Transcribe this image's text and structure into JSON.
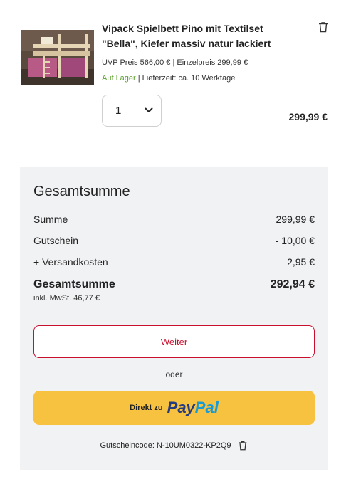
{
  "product": {
    "title": "Vipack Spielbett Pino mit Textilset \"Bella\", Kiefer massiv natur lackiert",
    "uvp_label": "UVP Preis",
    "uvp_value": "566,00 €",
    "unit_label": "| Einzelpreis",
    "unit_value": "299,99 €",
    "stock": "Auf Lager",
    "delivery_label": "| Lieferzeit:",
    "delivery_value": "ca. 10 Werktage",
    "quantity": "1",
    "total": "299,99 €",
    "remove_icon": "trash-icon"
  },
  "summary": {
    "heading": "Gesamtsumme",
    "rows": [
      {
        "label": "Summe",
        "value": "299,99 €"
      },
      {
        "label": "Gutschein",
        "value": "- 10,00 €"
      },
      {
        "label": "+ Versandkosten",
        "value": "2,95 €"
      }
    ],
    "total_label": "Gesamtsumme",
    "total_value": "292,94 €",
    "vat": "inkl. MwSt. 46,77 €"
  },
  "actions": {
    "continue_label": "Weiter",
    "or_label": "oder",
    "paypal_prefix": "Direkt zu",
    "paypal_word1": "Pay",
    "paypal_word2": "Pal"
  },
  "coupon": {
    "text": "Gutscheincode: N-10UM0322-KP2Q9",
    "remove_icon": "trash-icon"
  },
  "colors": {
    "accent_red": "#c8102e",
    "stock_green": "#5aa02c",
    "paypal_yellow": "#f7c240",
    "summary_bg": "#f1f2f4"
  }
}
